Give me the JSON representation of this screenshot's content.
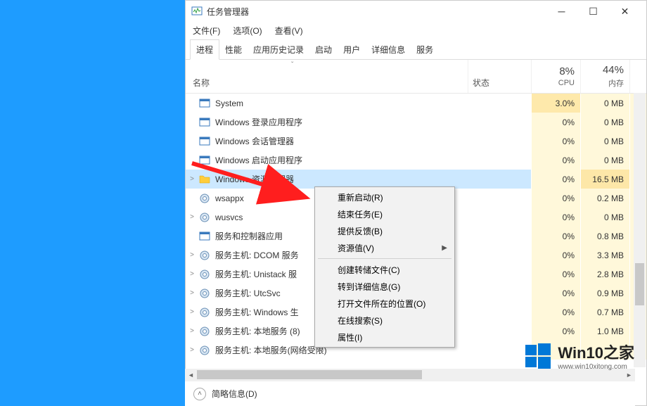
{
  "window": {
    "title": "任务管理器"
  },
  "menu": {
    "file": "文件(F)",
    "options": "选项(O)",
    "view": "查看(V)"
  },
  "tabs": {
    "processes": "进程",
    "performance": "性能",
    "apphistory": "应用历史记录",
    "startup": "启动",
    "users": "用户",
    "details": "详细信息",
    "services": "服务"
  },
  "columns": {
    "name": "名称",
    "status": "状态",
    "cpu_pct": "8%",
    "cpu_lbl": "CPU",
    "mem_pct": "44%",
    "mem_lbl": "内存"
  },
  "rows": [
    {
      "expand": "",
      "icon": "app",
      "name": "System",
      "cpu": "3.0%",
      "mem": "0 MB",
      "over": "0",
      "cpu_warm": true,
      "mem_warm": false,
      "indent": 1
    },
    {
      "expand": "",
      "icon": "app",
      "name": "Windows 登录应用程序",
      "cpu": "0%",
      "mem": "0 MB",
      "over": "0",
      "indent": 1
    },
    {
      "expand": "",
      "icon": "app",
      "name": "Windows 会话管理器",
      "cpu": "0%",
      "mem": "0 MB",
      "over": "0",
      "indent": 1
    },
    {
      "expand": "",
      "icon": "app",
      "name": "Windows 启动应用程序",
      "cpu": "0%",
      "mem": "0 MB",
      "over": "0",
      "indent": 1
    },
    {
      "expand": ">",
      "icon": "folder",
      "name": "Windows 资源管理器",
      "cpu": "0%",
      "mem": "16.5 MB",
      "over": "0",
      "mem_warm": true,
      "selected": true,
      "indent": 0
    },
    {
      "expand": "",
      "icon": "gear",
      "name": "wsappx",
      "cpu": "0%",
      "mem": "0.2 MB",
      "over": "0",
      "indent": 1
    },
    {
      "expand": ">",
      "icon": "gear",
      "name": "wusvcs",
      "cpu": "0%",
      "mem": "0 MB",
      "over": "0",
      "indent": 0
    },
    {
      "expand": "",
      "icon": "app",
      "name": "服务和控制器应用",
      "cpu": "0%",
      "mem": "0.8 MB",
      "over": "0",
      "indent": 1
    },
    {
      "expand": ">",
      "icon": "gear",
      "name": "服务主机: DCOM 服务",
      "cpu": "0%",
      "mem": "3.3 MB",
      "over": "0",
      "indent": 0
    },
    {
      "expand": ">",
      "icon": "gear",
      "name": "服务主机: Unistack 服",
      "cpu": "0%",
      "mem": "2.8 MB",
      "over": "0",
      "indent": 0
    },
    {
      "expand": ">",
      "icon": "gear",
      "name": "服务主机: UtcSvc",
      "cpu": "0%",
      "mem": "0.9 MB",
      "over": "0",
      "indent": 0
    },
    {
      "expand": ">",
      "icon": "gear",
      "name": "服务主机: Windows 生",
      "cpu": "0%",
      "mem": "0.7 MB",
      "over": "0",
      "indent": 0
    },
    {
      "expand": ">",
      "icon": "gear",
      "name": "服务主机: 本地服务 (8)",
      "cpu": "0%",
      "mem": "1.0 MB",
      "over": "0",
      "indent": 0
    },
    {
      "expand": ">",
      "icon": "gear",
      "name": "服务主机: 本地服务(网络受限)",
      "cpu": "",
      "mem": "",
      "over": "",
      "indent": 0
    }
  ],
  "context_menu": {
    "restart": "重新启动(R)",
    "end_task": "结束任务(E)",
    "feedback": "提供反馈(B)",
    "resource_values": "资源值(V)",
    "create_dump": "创建转储文件(C)",
    "go_details": "转到详细信息(G)",
    "open_location": "打开文件所在的位置(O)",
    "search_online": "在线搜索(S)",
    "properties": "属性(I)"
  },
  "footer": {
    "brief": "简略信息(D)"
  },
  "watermark": {
    "brand": "Win10之家",
    "url": "www.win10xitong.com"
  }
}
